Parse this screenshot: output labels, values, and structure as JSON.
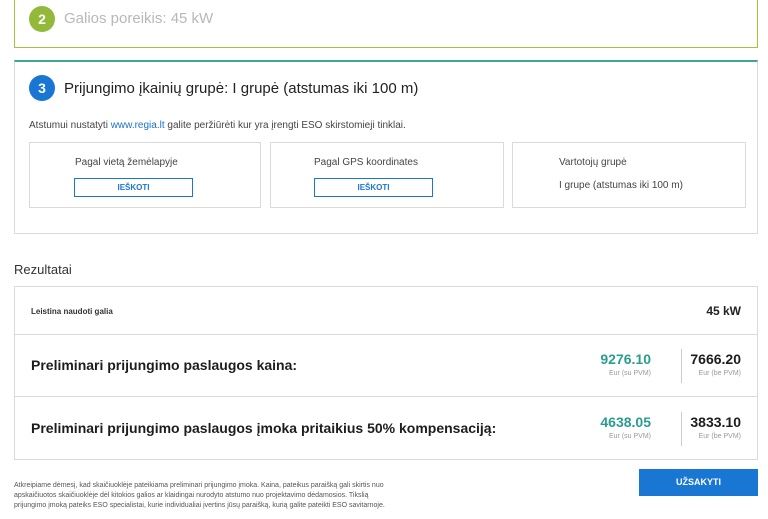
{
  "step2": {
    "number": "2",
    "title": "Galios poreikis: 45 kW"
  },
  "step3": {
    "number": "3",
    "title": "Prijungimo įkainių grupė: I grupė (atstumas iki 100 m)",
    "note_prefix": "Atstumui nustatyti",
    "note_link": "www.regia.lt",
    "note_suffix": "galite peržiūrėti kur yra įrengti ESO skirstomieji tinklai.",
    "options": [
      {
        "label": "Pagal vietą žemėlapyje",
        "button": "IEŠKOTI"
      },
      {
        "label": "Pagal GPS koordinates",
        "button": "IEŠKOTI"
      },
      {
        "label": "Vartotojų grupė",
        "value": "I grupe (atstumas iki 100 m)"
      }
    ]
  },
  "results": {
    "heading": "Rezultatai",
    "allowed_power_label": "Leistina naudoti galia",
    "allowed_power_value": "45 kW",
    "rows": [
      {
        "label": "Preliminari prijungimo paslaugos kaina:",
        "with_vat": "9276.10",
        "with_vat_unit": "Eur (su PVM)",
        "without_vat": "7666.20",
        "without_vat_unit": "Eur (be PVM)"
      },
      {
        "label": "Preliminari prijungimo paslaugos įmoka pritaikius 50% kompensaciją:",
        "with_vat": "4638.05",
        "with_vat_unit": "Eur (su PVM)",
        "without_vat": "3833.10",
        "without_vat_unit": "Eur (be PVM)"
      }
    ]
  },
  "disclaimer": "Atkreipiame dėmesį, kad skaičiuoklėje pateikiama preliminari prijungimo įmoka. Kaina, pateikus paraišką gali skirtis nuo apskaičiuotos skaičiuoklėje dėl kitokios galios ar klaidingai nurodyto atstumo nuo projektavimo dėdamosios. Tikslią prijungimo įmoką pateiks ESO specialistai, kurie individualiai įvertins jūsų paraišką, kurią galite pateikti ESO savitarnoje.",
  "order_button": "UŽSAKYTI",
  "colors": {
    "accent": "#1976d2",
    "step_done": "#93b93a",
    "teal": "#2a9d8f"
  }
}
